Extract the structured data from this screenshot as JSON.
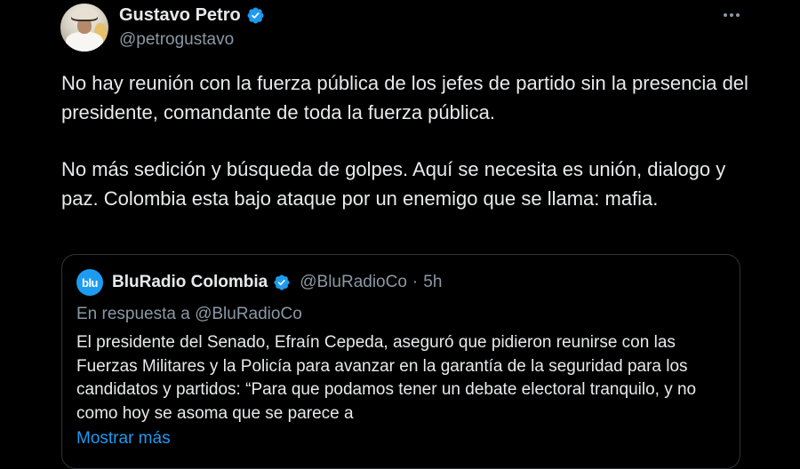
{
  "author": {
    "name": "Gustavo Petro",
    "handle": "@petrogustavo",
    "verified": true,
    "avatar_icon": "profile-photo"
  },
  "tweet": {
    "paragraphs": [
      "No hay reunión con la fuerza pública de los jefes de partido sin la presencia del presidente, comandante de toda la fuerza pública.",
      "No más sedición y búsqueda de golpes. Aquí se necesita es unión, dialogo y paz. Colombia esta bajo ataque por un enemigo que se llama: mafia."
    ]
  },
  "quoted_tweet": {
    "avatar_text": "blu",
    "name": "BluRadio Colombia",
    "handle": "@BluRadioCo",
    "separator": "·",
    "time": "5h",
    "reply_to": "En respuesta a @BluRadioCo",
    "body": "El presidente del Senado, Efraín Cepeda, aseguró que pidieron reunirse con las Fuerzas Militares y la Policía para avanzar en la garantía de la seguridad para los candidatos y partidos: “Para que podamos tener un debate electoral tranquilo, y no como hoy se asoma que se parece a",
    "show_more": "Mostrar más"
  },
  "colors": {
    "background": "#000000",
    "text": "#e7e9ea",
    "secondary_text": "#8b98a5",
    "accent": "#1d9bf0",
    "border": "#2f3336"
  }
}
